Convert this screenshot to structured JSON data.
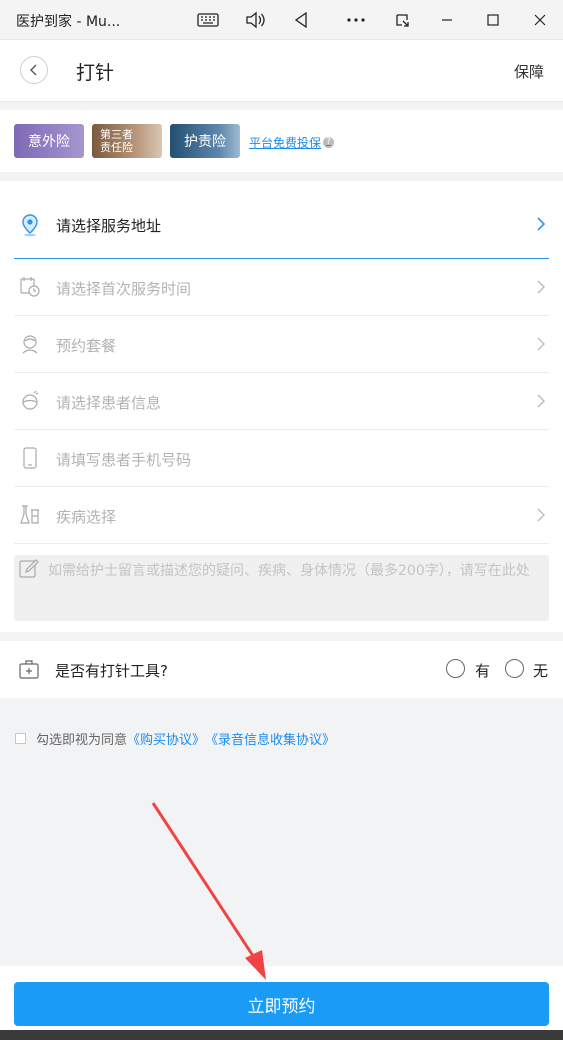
{
  "window": {
    "title": "医护到家 - Mu...",
    "icons": [
      "keyboard-icon",
      "volume-icon",
      "back-triangle-icon",
      "more-icon",
      "snap-icon",
      "minimize-icon",
      "maximize-icon",
      "close-icon"
    ]
  },
  "header": {
    "title": "打针",
    "right_link": "保障"
  },
  "insurance": {
    "badges": [
      {
        "label": "意外险",
        "color": "#8a78bf"
      },
      {
        "label_line1": "第三者",
        "label_line2": "责任险",
        "color": "#8a6a4e"
      },
      {
        "label": "护责险",
        "color": "#2f5f86"
      }
    ],
    "free_claim": "平台免费投保"
  },
  "form": {
    "address": "请选择服务地址",
    "first_time": "请选择首次服务时间",
    "package": "预约套餐",
    "patient": "请选择患者信息",
    "phone": "请填写患者手机号码",
    "disease": "疾病选择",
    "note_placeholder": "如需给护士留言或描述您的疑问、疾病、身体情况（最多200字），请写在此处"
  },
  "tool_question": {
    "question": "是否有打针工具?",
    "yes": "有",
    "no": "无"
  },
  "agreement": {
    "prefix": "勾选即视为同意",
    "purchase": "《购买协议》",
    "recording": "《录音信息收集协议》"
  },
  "submit": {
    "label": "立即预约"
  },
  "colors": {
    "primary": "#1a9bf5",
    "link": "#1c8cf0",
    "annotation_arrow": "#f04444"
  }
}
